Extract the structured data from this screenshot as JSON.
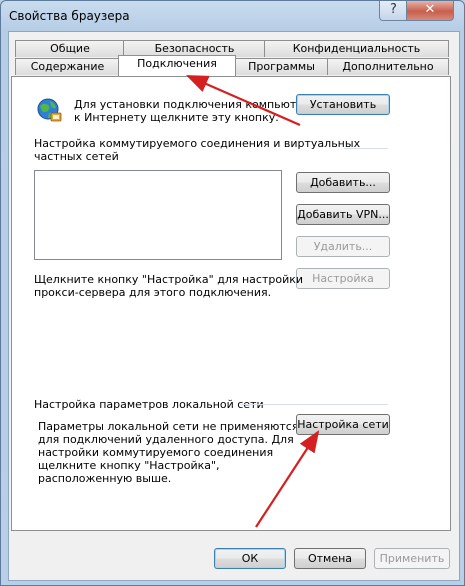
{
  "window": {
    "title": "Свойства браузера",
    "help_label": "?",
    "close_label": "✕"
  },
  "tabs_row1": [
    "Общие",
    "Безопасность",
    "Конфиденциальность"
  ],
  "tabs_row2": [
    "Содержание",
    "Подключения",
    "Программы",
    "Дополнительно"
  ],
  "active_tab": "Подключения",
  "setup": {
    "text_line1": "Для установки подключения компьютера",
    "text_line2": "к Интернету щелкните эту кнопку.",
    "button": "Установить",
    "icon": "globe-network-icon"
  },
  "dialup": {
    "heading_line1": "Настройка коммутируемого соединения и виртуальных",
    "heading_line2": "частных сетей",
    "add_button": "Добавить...",
    "add_vpn_button": "Добавить VPN...",
    "remove_button": "Удалить...",
    "settings_button": "Настройка",
    "hint_line1": "Щелкните кнопку \"Настройка\" для настройки",
    "hint_line2": "прокси-сервера для этого подключения."
  },
  "lan": {
    "heading": "Настройка параметров локальной сети",
    "text_line1": "Параметры локальной сети не применяются",
    "text_line2": "для подключений удаленного доступа. Для",
    "text_line3": "настройки коммутируемого соединения",
    "text_line4": "щелкните кнопку \"Настройка\",",
    "text_line5": "расположенную выше.",
    "button": "Настройка сети"
  },
  "footer": {
    "ok": "ОК",
    "cancel": "Отмена",
    "apply": "Применить"
  },
  "colors": {
    "annotation_arrow": "#d42020",
    "window_frame": "#b9cfe7"
  }
}
